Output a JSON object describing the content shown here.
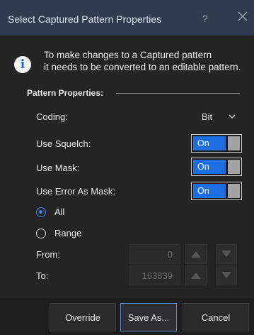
{
  "dialog": {
    "title": "Select Captured Pattern Properties",
    "help_label": "?",
    "info_text_line1": "To make changes to a Captured pattern",
    "info_text_line2": "it needs to be converted to an editable pattern."
  },
  "pattern_properties": {
    "section_label": "Pattern Properties:",
    "coding_label": "Coding:",
    "coding_value": "Bit",
    "use_squelch_label": "Use Squelch:",
    "use_squelch_value": "On",
    "use_mask_label": "Use Mask:",
    "use_mask_value": "On",
    "use_error_as_mask_label": "Use Error As Mask:",
    "use_error_as_mask_value": "On",
    "radio_all_label": "All",
    "radio_range_label": "Range",
    "selected_range_option": "All",
    "from_label": "From:",
    "from_value": "0",
    "to_label": "To:",
    "to_value": "163839"
  },
  "buttons": {
    "override": "Override",
    "save_as": "Save As...",
    "cancel": "Cancel"
  },
  "colors": {
    "accent": "#1d6ee0",
    "title_bar": "#2f3c4f",
    "background": "#242424"
  },
  "icons": [
    "close-icon",
    "info-icon",
    "chevron-down-icon",
    "arrow-up-icon",
    "arrow-down-icon"
  ]
}
